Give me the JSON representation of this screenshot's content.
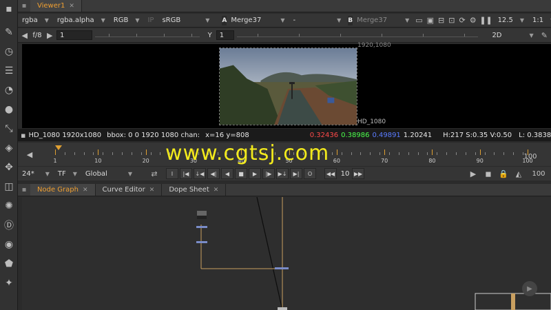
{
  "viewer_tab": {
    "label": "Viewer1"
  },
  "viewer_controls": {
    "channels": "rgba",
    "alpha_channel": "rgba.alpha",
    "display": "RGB",
    "ip_label": "IP",
    "colorspace": "sRGB",
    "a_label": "A",
    "a_input": "Merge37",
    "composite": "-",
    "b_label": "B",
    "b_input": "Merge37",
    "zoom_value": "12.5",
    "proxy_scale": "1:1"
  },
  "gain_row": {
    "fstop": "f/8",
    "gain_value": "1",
    "gamma_label": "Y",
    "gamma_value": "1",
    "view_mode": "2D"
  },
  "viewport": {
    "format_top": "1920,1080",
    "format_bottom": "HD_1080"
  },
  "info_bar": {
    "format": "HD_1080 1920x1080",
    "bbox": "bbox: 0 0 1920 1080 chan:",
    "coords": "x=16 y=808",
    "r": "0.32436",
    "g": "0.38986",
    "b": "0.49891",
    "a": "1.20241",
    "hsv": "H:217 S:0.35 V:0.50",
    "l": "L: 0.38381",
    "r_color": "#ff4a4a",
    "g_color": "#4cff4c",
    "b_color": "#5a7cff",
    "swatch_color": "#8a9ab0"
  },
  "timeline": {
    "labels": [
      "1",
      "10",
      "20",
      "30",
      "40",
      "50",
      "60",
      "70",
      "80",
      "90",
      "100"
    ],
    "right_value": "100"
  },
  "playback": {
    "fps": "24*",
    "tf": "TF",
    "scope": "Global",
    "increment": "10",
    "end_frame": "100"
  },
  "bottom_tabs": [
    {
      "label": "Node Graph"
    },
    {
      "label": "Curve Editor"
    },
    {
      "label": "Dope Sheet"
    }
  ],
  "watermark": "www.cgtsj.com"
}
